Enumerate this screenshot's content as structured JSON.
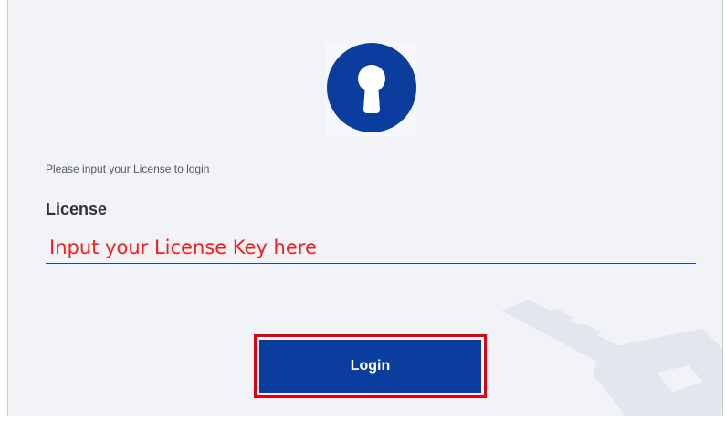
{
  "prompt_text": "Please input your License to login",
  "license": {
    "label": "License",
    "placeholder": "Input your License Key here",
    "value": ""
  },
  "login_button_label": "Login",
  "icons": {
    "lock": "keyhole-lock-icon",
    "watermark": "key-watermark-icon"
  },
  "colors": {
    "brand_blue": "#0b3d9e",
    "annotation_red": "#e0000f",
    "background": "#f1f3f7"
  }
}
